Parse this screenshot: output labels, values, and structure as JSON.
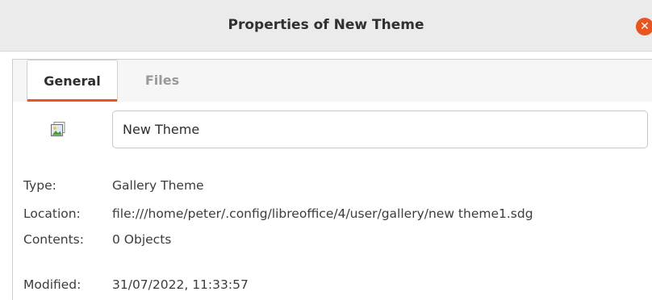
{
  "window": {
    "title": "Properties of New Theme",
    "close_glyph": "✕"
  },
  "tabs": [
    {
      "label": "General",
      "active": true
    },
    {
      "label": "Files",
      "active": false
    }
  ],
  "general": {
    "icon": "image-icon",
    "name_value": "New Theme",
    "type_label": "Type:",
    "type_value": "Gallery Theme",
    "location_label": "Location:",
    "location_value": "file:///home/peter/.config/libreoffice/4/user/gallery/new theme1.sdg",
    "contents_label": "Contents:",
    "contents_value": "0 Objects",
    "modified_label": "Modified:",
    "modified_value": "31/07/2022, 11:33:57"
  },
  "colors": {
    "accent": "#e95420",
    "titlebar": "#ebebeb"
  }
}
